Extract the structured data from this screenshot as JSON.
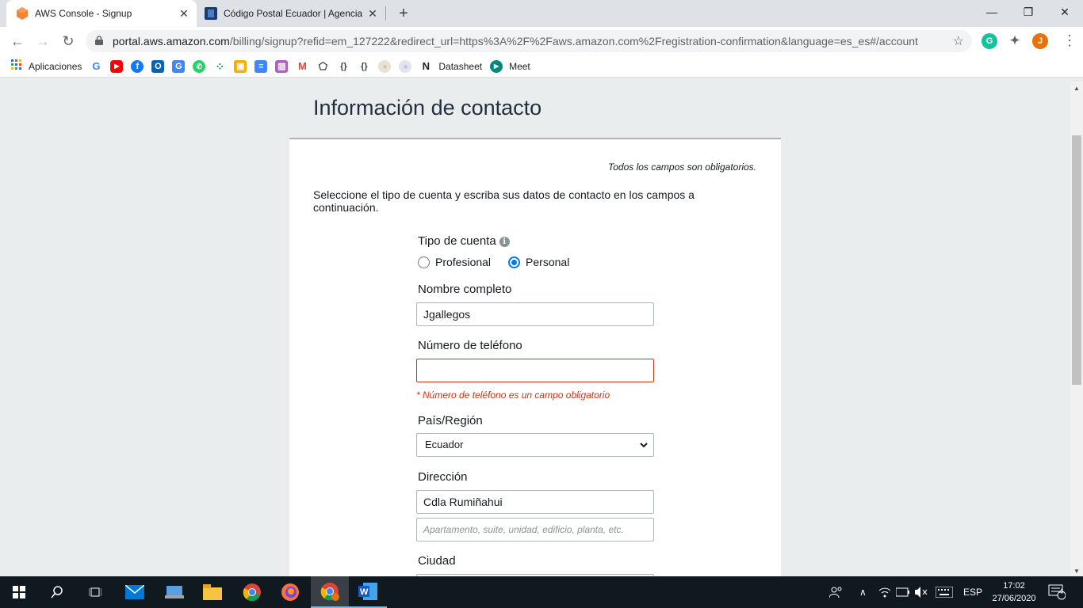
{
  "browser": {
    "tabs": [
      {
        "label": "AWS Console - Signup",
        "active": true,
        "icon": "aws-icon"
      },
      {
        "label": "Código Postal Ecuador | Agencia",
        "active": false,
        "icon": "site-icon"
      }
    ],
    "new_tab_label": "+",
    "url": {
      "host": "portal.aws.amazon.com",
      "path": "/billing/signup?refid=em_127222&redirect_url=https%3A%2F%2Faws.amazon.com%2Fregistration-confirmation&language=es_es#/account"
    },
    "profile_initial": "J",
    "extension_initial": "G",
    "bookmarks": [
      {
        "label": "Aplicaciones",
        "icon": "apps-grid-icon"
      },
      {
        "label": "",
        "icon": "google-icon"
      },
      {
        "label": "",
        "icon": "youtube-icon"
      },
      {
        "label": "",
        "icon": "facebook-icon"
      },
      {
        "label": "",
        "icon": "outlook-icon"
      },
      {
        "label": "",
        "icon": "translate-icon"
      },
      {
        "label": "",
        "icon": "whatsapp-icon"
      },
      {
        "label": "",
        "icon": "dots-icon"
      },
      {
        "label": "",
        "icon": "classroom-icon"
      },
      {
        "label": "",
        "icon": "docs-icon"
      },
      {
        "label": "",
        "icon": "pattern-icon"
      },
      {
        "label": "",
        "icon": "gmail-icon"
      },
      {
        "label": "",
        "icon": "shape-icon"
      },
      {
        "label": "",
        "icon": "bracket-icon"
      },
      {
        "label": "",
        "icon": "bracket-icon"
      },
      {
        "label": "",
        "icon": "stamp-icon"
      },
      {
        "label": "",
        "icon": "stamp-icon"
      },
      {
        "label": "Datasheet",
        "icon": "datasheet-icon"
      },
      {
        "label": "Meet",
        "icon": "meet-icon"
      }
    ]
  },
  "page": {
    "heading": "Información de contacto",
    "required_note": "Todos los campos son obligatorios.",
    "intro": "Seleccione el tipo de cuenta y escriba sus datos de contacto en los campos a continuación.",
    "account_type": {
      "label": "Tipo de cuenta",
      "options": [
        "Profesional",
        "Personal"
      ],
      "selected": "Personal"
    },
    "full_name": {
      "label": "Nombre completo",
      "value": "Jgallegos"
    },
    "phone": {
      "label": "Número de teléfono",
      "value": "",
      "error": "* Número de teléfono es un campo obligatorio"
    },
    "country": {
      "label": "País/Región",
      "value": "Ecuador"
    },
    "address": {
      "label": "Dirección",
      "value": "Cdla Rumiñahui",
      "placeholder2": "Apartamento, suite, unidad, edificio, planta, etc."
    },
    "city": {
      "label": "Ciudad"
    }
  },
  "taskbar": {
    "language": "ESP",
    "time": "17:02",
    "date": "27/06/2020",
    "notifications": "4"
  }
}
